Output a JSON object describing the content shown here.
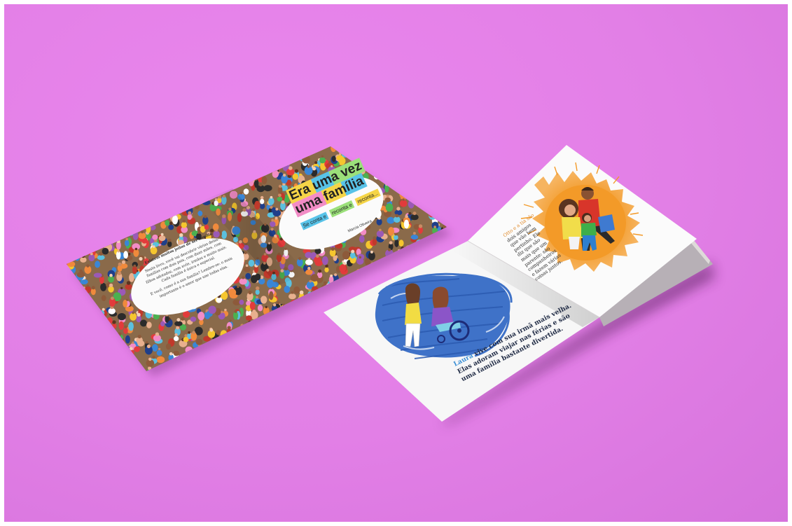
{
  "scene": {
    "background_color": "#e47fe8",
    "subject": "two copies of a children's picture book on a pink surface"
  },
  "book_cover": {
    "title_line1": "Era uma vez",
    "title_line2": "uma família",
    "subtitle_parts": [
      "Se conta e",
      "reconta e",
      "reconta..."
    ],
    "author": "Marcia Oliveira",
    "title_colors": [
      "#f5d547",
      "#58c3e8",
      "#9be07a",
      "#f28cc6",
      "#f08a3c"
    ]
  },
  "back_cover": {
    "heading": "Existem muitos jeitos de ser família.",
    "body": "Nesta livro, você vai descobrir várias delas: famílias com dois pais, com duas mães, com filhos adotados, com avós, irmãos e muito mais. Cada família é única e especial.",
    "closing": "E você, como é a sua família? Lembre-se: o mais importante é o amor que une todas elas."
  },
  "inside_left": {
    "name": "Laura",
    "text": [
      " vive com sua irmã mais velha.",
      "Elas adoram viajar nas férias e são",
      "uma família bastante divertida."
    ]
  },
  "inside_right": {
    "text": [
      "Otto e a tia são",
      "dois amigos",
      "que vão bem",
      "pertinho. Ele",
      "diz que são",
      "mais que um",
      "parente: são",
      "companheiros",
      "e fazem várias",
      "coisas juntos."
    ]
  }
}
